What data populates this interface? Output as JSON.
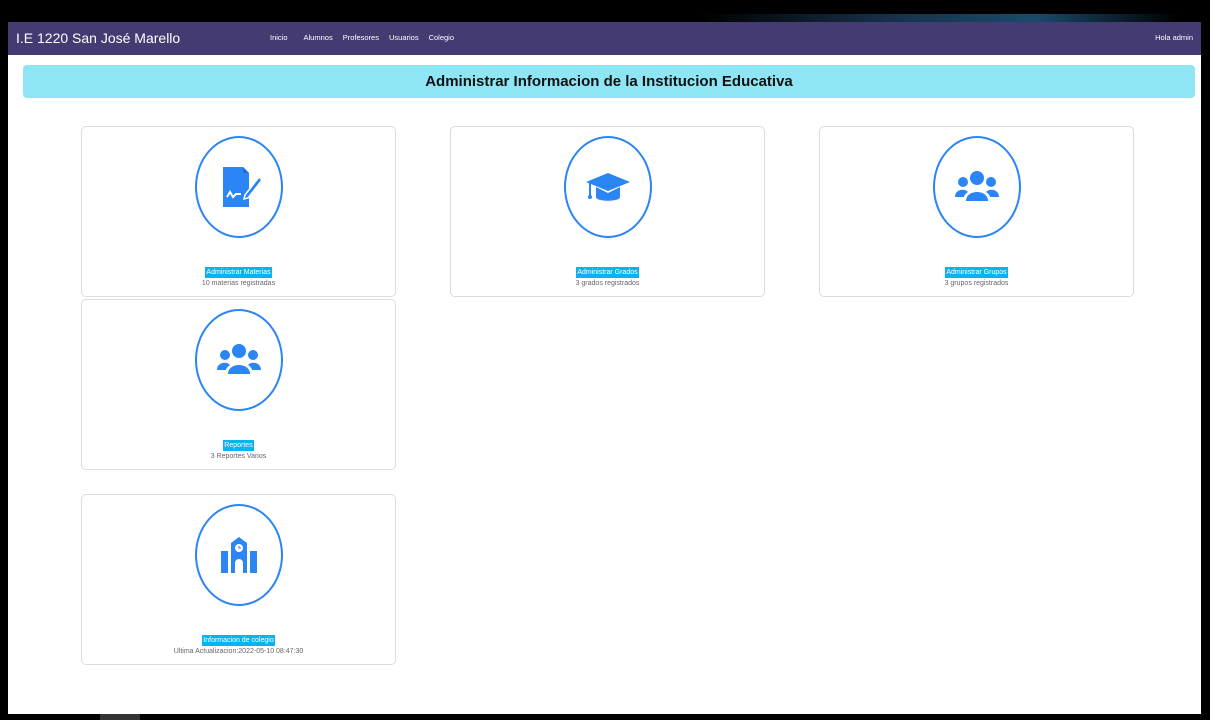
{
  "navbar": {
    "brand": "I.E 1220 San José Marello",
    "links": [
      "Inicio",
      "Alumnos",
      "Profesores",
      "Usuarios",
      "Colegio"
    ],
    "greeting": "Hola admin"
  },
  "banner": {
    "title": "Administrar Informacion de la Institucion Educativa"
  },
  "cards": [
    {
      "icon": "file-signature-icon",
      "link": "Administrar Materias",
      "desc": "10 materias registradas"
    },
    {
      "icon": "graduation-cap-icon",
      "link": "Administrar Grados",
      "desc": "3 grados registrados"
    },
    {
      "icon": "users-icon",
      "link": "Administrar Grupos",
      "desc": "3 grupos registrados"
    },
    {
      "icon": "users-icon",
      "link": "Reportes",
      "desc": "3 Reportes Varios"
    },
    {
      "icon": "school-icon",
      "link": "Informacion de colegio",
      "desc": "Ultima Actualizacion:2022-05-10 08:47:30"
    }
  ],
  "colors": {
    "navbar": "#433b72",
    "banner": "#8ee6f4",
    "accent": "#2b85f4",
    "link_bg": "#0bb3ee"
  }
}
